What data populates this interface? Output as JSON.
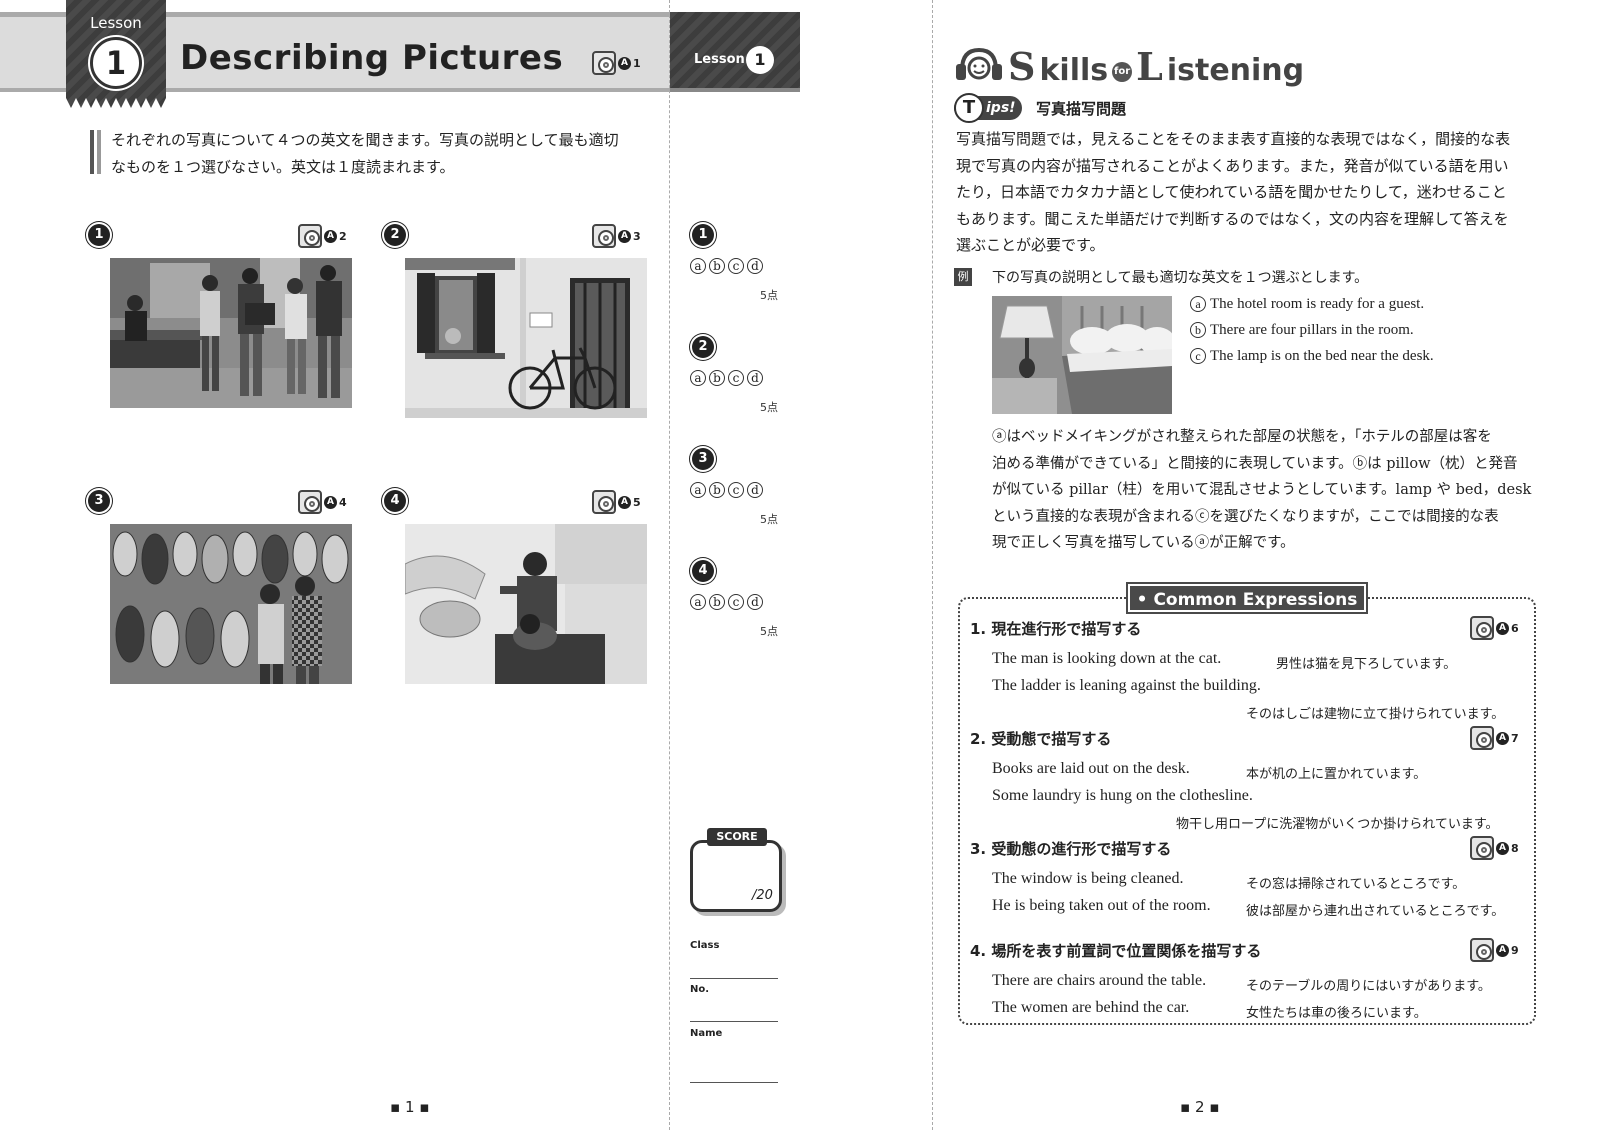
{
  "left_page": {
    "lesson_label": "Lesson",
    "lesson_number": "1",
    "title": "Describing Pictures",
    "title_track": "1",
    "instructions_line1": "それぞれの写真について４つの英文を聞きます。写真の説明として最も適切",
    "instructions_line2": "なものを１つ選びなさい。英文は１度読まれます。",
    "questions": [
      {
        "number": "1",
        "track": "2",
        "photo": "students-at-counter"
      },
      {
        "number": "2",
        "track": "3",
        "photo": "bicycle-by-window"
      },
      {
        "number": "3",
        "track": "4",
        "photo": "guitar-shop"
      },
      {
        "number": "4",
        "track": "5",
        "photo": "dentist"
      }
    ],
    "page_number": "1"
  },
  "answer_column": {
    "lesson_label": "Lesson",
    "lesson_number": "1",
    "items": [
      {
        "number": "1",
        "options": [
          "a",
          "b",
          "c",
          "d"
        ],
        "points": "5点"
      },
      {
        "number": "2",
        "options": [
          "a",
          "b",
          "c",
          "d"
        ],
        "points": "5点"
      },
      {
        "number": "3",
        "options": [
          "a",
          "b",
          "c",
          "d"
        ],
        "points": "5点"
      },
      {
        "number": "4",
        "options": [
          "a",
          "b",
          "c",
          "d"
        ],
        "points": "5点"
      }
    ],
    "score_label": "SCORE",
    "score_total": "/20",
    "class_label": "Class",
    "no_label": "No.",
    "name_label": "Name"
  },
  "right_page": {
    "skills_s": "S",
    "skills_rest": "kills",
    "skills_for": "for",
    "skills_l": "L",
    "skills_rest2": "istening",
    "tips_t": "T",
    "tips_label": "ips!",
    "tips_title": "写真描写問題",
    "tips_lines": [
      "写真描写問題では，見えることをそのまま表す直接的な表現ではなく，間接的な表",
      "現で写真の内容が描写されることがよくあります。また，発音が似ている語を用い",
      "たり，日本語でカタカナ語として使われている語を聞かせたりして，迷わせること",
      "もあります。聞こえた単語だけで判断するのではなく，文の内容を理解して答えを",
      "選ぶことが必要です。"
    ],
    "example_mark": "例",
    "example_intro": "下の写真の説明として最も適切な英文を１つ選ぶとします。",
    "example_choices": [
      {
        "letter": "a",
        "text": "The hotel room is ready for a guest."
      },
      {
        "letter": "b",
        "text": "There are four pillars in the room."
      },
      {
        "letter": "c",
        "text": "The lamp is on the bed near the desk."
      }
    ],
    "explanation_lines": [
      "ⓐはベッドメイキングがされ整えられた部屋の状態を，「ホテルの部屋は客を",
      "泊める準備ができている」と間接的に表現しています。ⓑは pillow（枕）と発音",
      "が似ている pillar（柱）を用いて混乱させようとしています。lamp や bed，desk",
      "という直接的な表現が含まれるⓒを選びたくなりますが，ここでは間接的な表",
      "現で正しく写真を描写しているⓐが正解です。"
    ],
    "common_expressions_title": "Common Expressions",
    "expressions": [
      {
        "heading": "1. 現在進行形で描写する",
        "track": "6",
        "lines": [
          {
            "en": "The man is looking down at the cat.",
            "ja": "男性は猫を見下ろしています。"
          },
          {
            "en": "The ladder is leaning against the building.",
            "ja": "そのはしごは建物に立て掛けられています。"
          }
        ]
      },
      {
        "heading": "2. 受動態で描写する",
        "track": "7",
        "lines": [
          {
            "en": "Books are laid out on the desk.",
            "ja": "本が机の上に置かれています。"
          },
          {
            "en": "Some laundry is hung on the clothesline.",
            "ja": "物干し用ロープに洗濯物がいくつか掛けられています。"
          }
        ]
      },
      {
        "heading": "3. 受動態の進行形で描写する",
        "track": "8",
        "lines": [
          {
            "en": "The window is being cleaned.",
            "ja": "その窓は掃除されているところです。"
          },
          {
            "en": "He is being taken out of the room.",
            "ja": "彼は部屋から連れ出されているところです。"
          }
        ]
      },
      {
        "heading": "4. 場所を表す前置詞で位置関係を描写する",
        "track": "9",
        "lines": [
          {
            "en": "There are chairs around the table.",
            "ja": "そのテーブルの周りにはいすがあります。"
          },
          {
            "en": "The women are behind the car.",
            "ja": "女性たちは車の後ろにいます。"
          }
        ]
      }
    ],
    "page_number": "2"
  }
}
